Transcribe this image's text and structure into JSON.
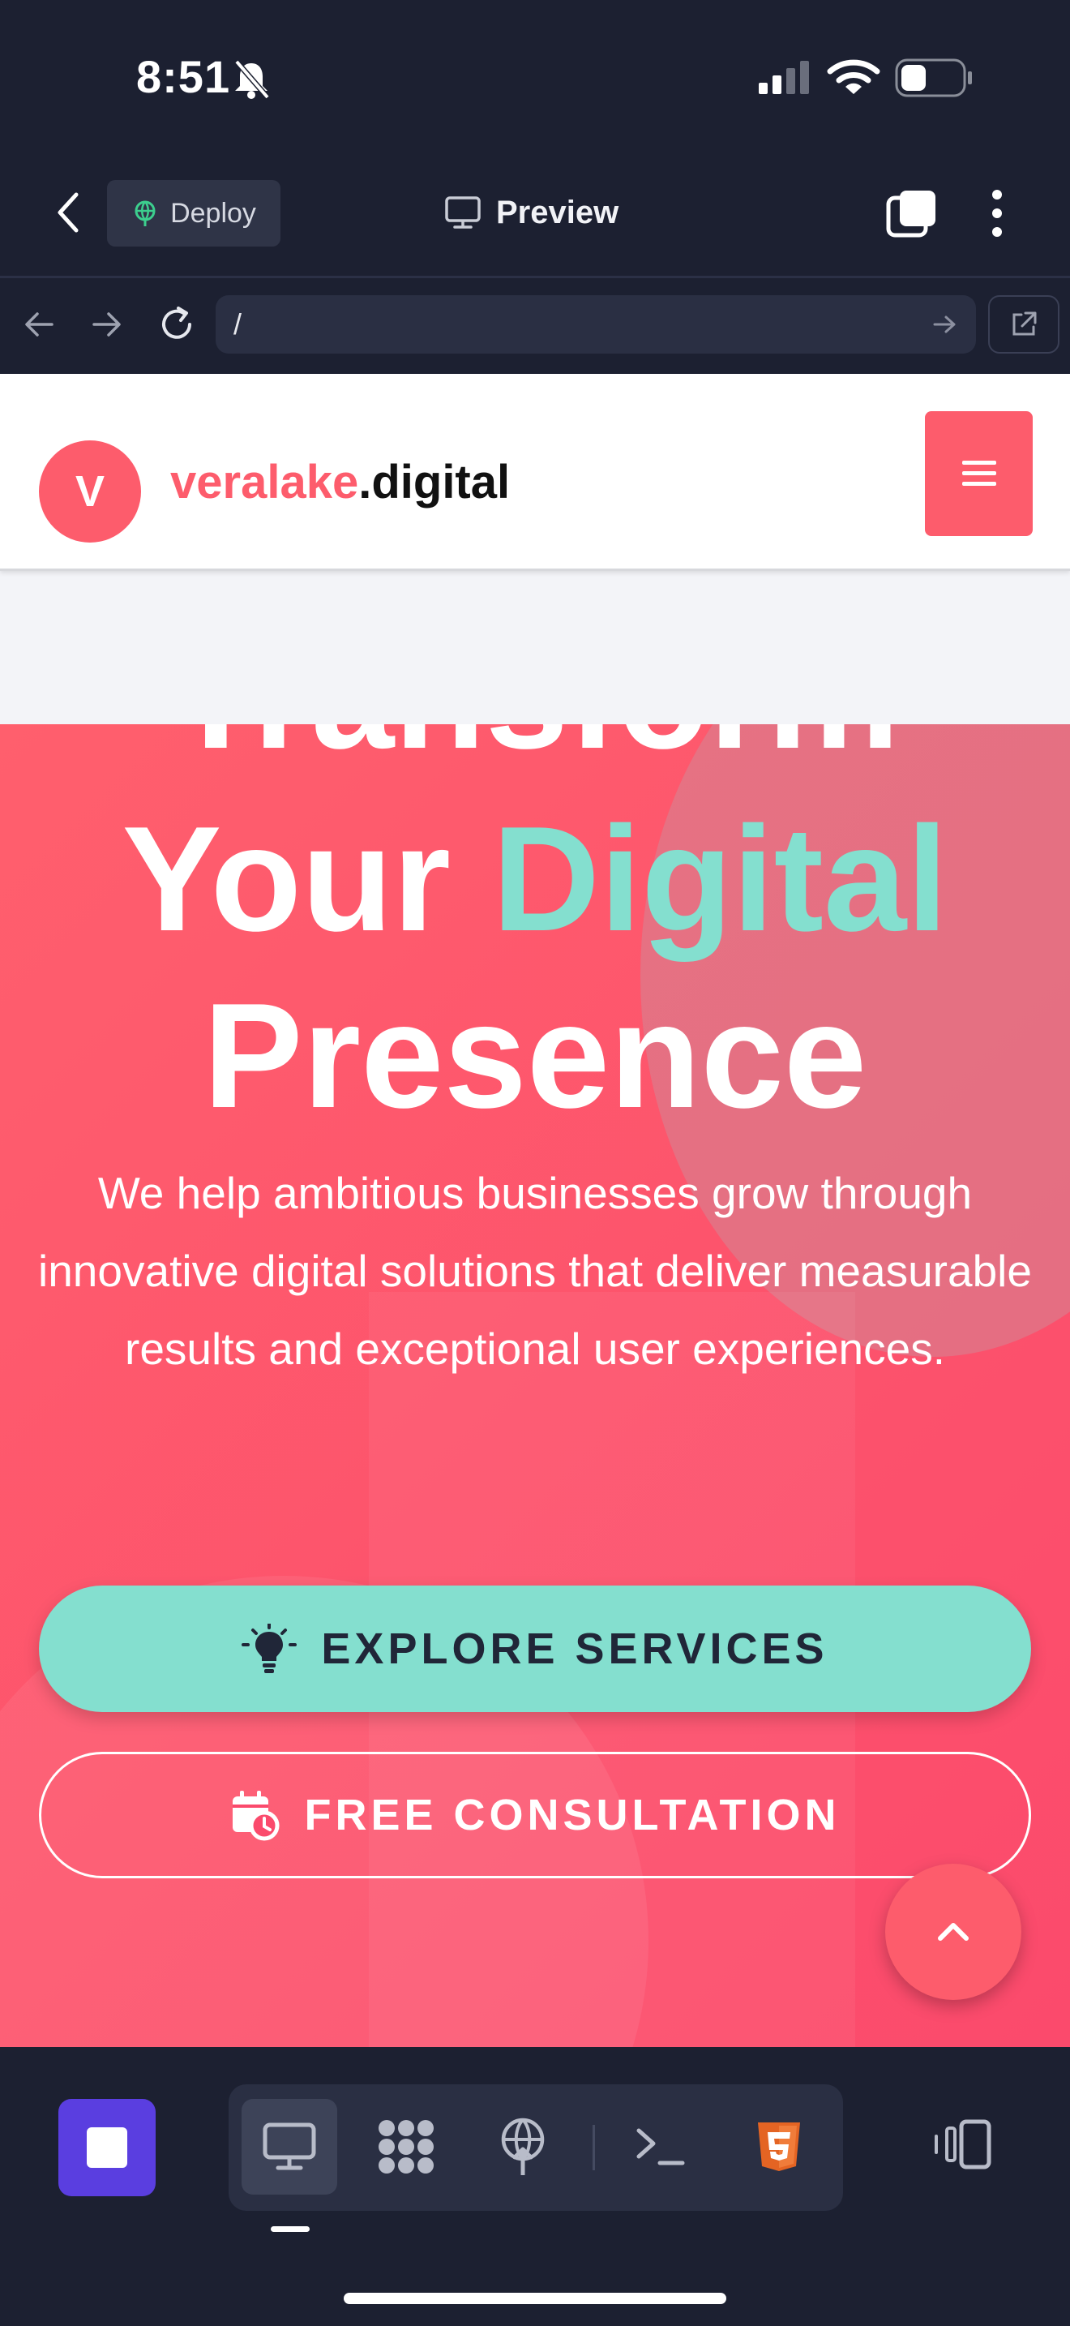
{
  "status_bar": {
    "time": "8:51",
    "icons": [
      "bell-slash-icon",
      "signal-icon",
      "wifi-icon",
      "battery-icon"
    ]
  },
  "toolbar": {
    "deploy_label": "Deploy",
    "preview_label": "Preview",
    "icons": [
      "back-icon",
      "deploy-icon",
      "monitor-icon",
      "tabs-icon",
      "more-icon"
    ]
  },
  "url_bar": {
    "url": "/",
    "icons": [
      "nav-back-icon",
      "nav-forward-icon",
      "reload-icon",
      "go-icon",
      "open-external-icon"
    ]
  },
  "site": {
    "logo_letter": "V",
    "brand_name": "veralake",
    "brand_tld": ".digital",
    "hero": {
      "line1": "Transform",
      "line2_plain": "Your ",
      "line2_accent": "Digital",
      "line3": "Presence",
      "subtitle": "We help ambitious businesses grow through innovative digital solutions that deliver measurable results and exceptional user experiences."
    },
    "cta_primary": "EXPLORE SERVICES",
    "cta_secondary": "FREE CONSULTATION",
    "colors": {
      "brand": "#fd5c6c",
      "accent": "#84dfcf",
      "dark": "#1c2031"
    }
  },
  "bottom_bar": {
    "tools": [
      "preview-tool",
      "packages-tool",
      "deploy-tool",
      "terminal-tool",
      "html5-tool"
    ],
    "active_tool": "preview-tool"
  }
}
